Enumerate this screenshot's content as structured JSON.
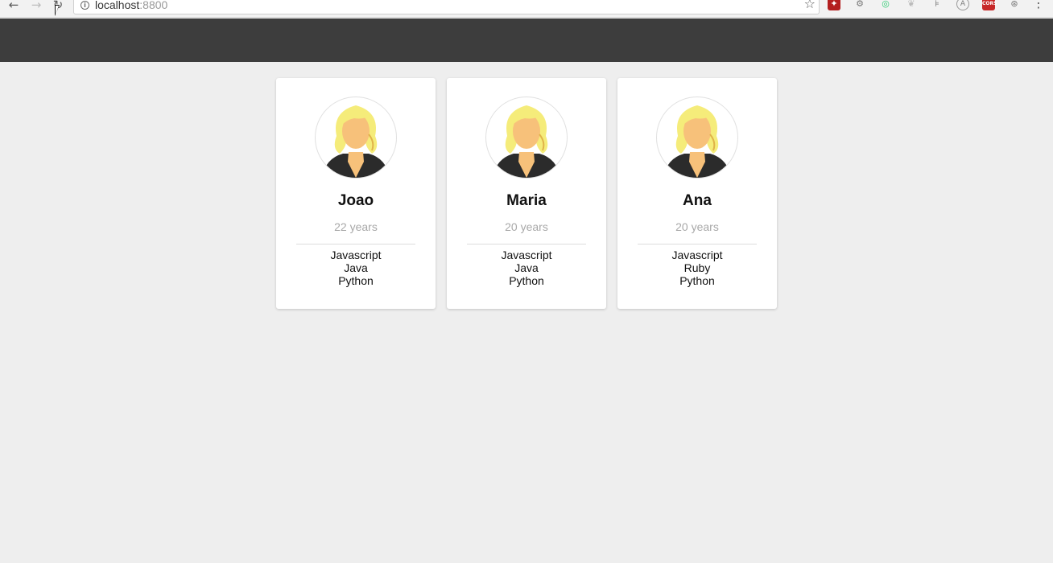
{
  "browser": {
    "url_host": "localhost",
    "url_port": ":8800"
  },
  "people": [
    {
      "name": "Joao",
      "age": "22 years",
      "skills": [
        "Javascript",
        "Java",
        "Python"
      ]
    },
    {
      "name": "Maria",
      "age": "20 years",
      "skills": [
        "Javascript",
        "Java",
        "Python"
      ]
    },
    {
      "name": "Ana",
      "age": "20 years",
      "skills": [
        "Javascript",
        "Ruby",
        "Python"
      ]
    }
  ],
  "colors": {
    "header_bg": "#3d3d3d",
    "page_bg": "#eeeeee",
    "card_bg": "#ffffff",
    "age_text": "#a8a8a8"
  },
  "icons": {
    "avatar": "female-avatar-icon",
    "back": "back-arrow-icon",
    "forward": "forward-arrow-icon",
    "reload": "reload-icon",
    "bookmark": "star-icon",
    "menu": "vertical-dots-icon"
  }
}
